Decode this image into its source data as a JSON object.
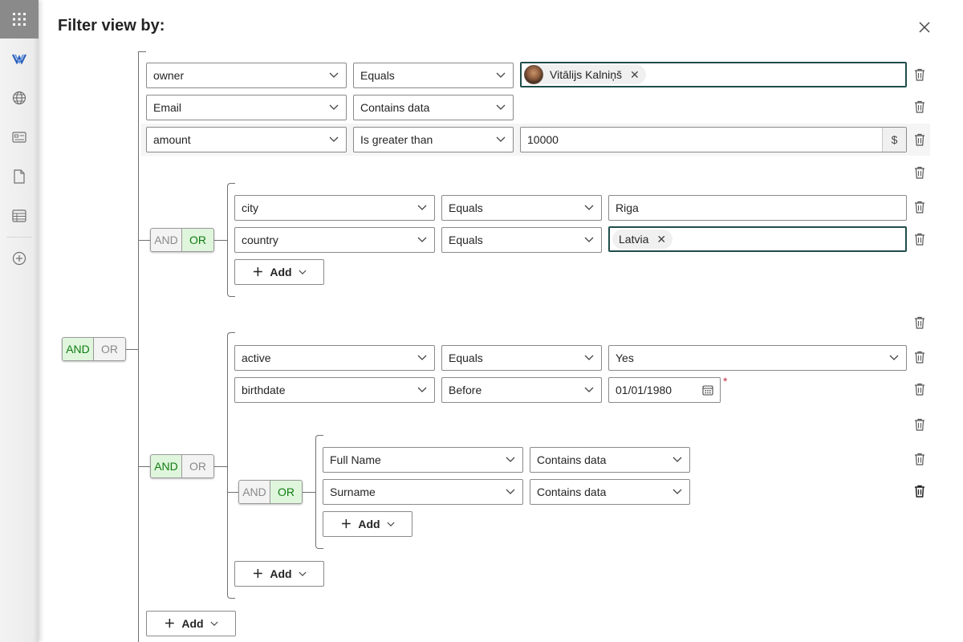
{
  "title": "Filter view by:",
  "icons": {
    "waffle": "app-launcher-icon",
    "logo": "brand-logo-icon",
    "globe": "globe-icon",
    "card": "contact-card-icon",
    "doc": "document-icon",
    "table": "table-icon",
    "add": "add-circle-icon",
    "close": "close-icon",
    "trash": "trash-icon",
    "calendar": "calendar-icon",
    "chevron": "chevron-down-icon"
  },
  "colors": {
    "active_toggle": "#107c10",
    "active_toggle_bg": "#dff6dd",
    "required": "#c4314b",
    "focus_border": "#1f4d4a"
  },
  "logic": {
    "and": "AND",
    "or": "OR"
  },
  "add_label": "Add",
  "rows": {
    "owner": {
      "field": "owner",
      "operator": "Equals",
      "value": "Vitālijs Kalniņš"
    },
    "email": {
      "field": "Email",
      "operator": "Contains data"
    },
    "amount": {
      "field": "amount",
      "operator": "Is greater than",
      "value": "10000",
      "suffix": "$"
    },
    "city": {
      "field": "city",
      "operator": "Equals",
      "value": "Riga"
    },
    "country": {
      "field": "country",
      "operator": "Equals",
      "value": "Latvia"
    },
    "active": {
      "field": "active",
      "operator": "Equals",
      "value": "Yes"
    },
    "birthdate": {
      "field": "birthdate",
      "operator": "Before",
      "value": "01/01/1980",
      "required": "*"
    },
    "fullname": {
      "field": "Full Name",
      "operator": "Contains data"
    },
    "surname": {
      "field": "Surname",
      "operator": "Contains data"
    }
  }
}
